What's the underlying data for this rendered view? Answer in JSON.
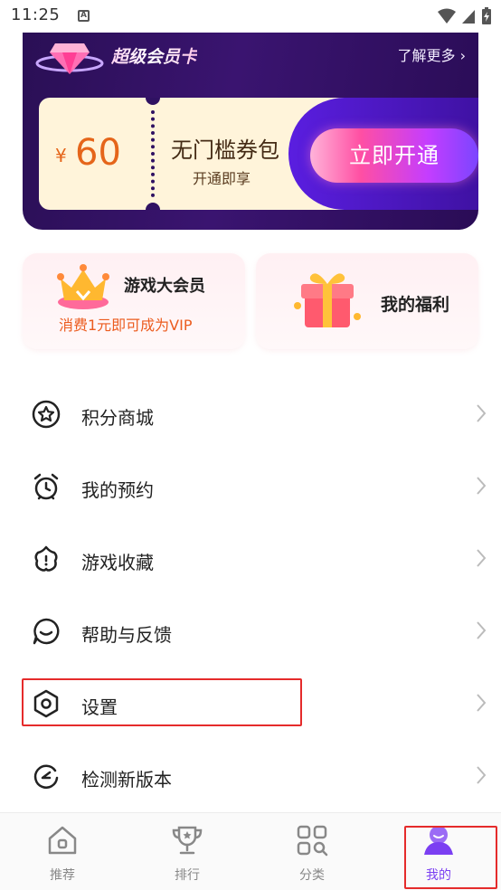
{
  "status_bar": {
    "time": "11:25",
    "app_icon_letter": "A"
  },
  "vip_card": {
    "title": "超级会员卡",
    "more_link": "了解更多 ›",
    "coupon": {
      "currency": "¥",
      "amount": "60",
      "name": "无门槛券包",
      "subtitle": "开通即享"
    },
    "open_button": "立即开通"
  },
  "promos": {
    "left": {
      "title": "游戏大会员",
      "subtitle": "消费1元即可成为VIP"
    },
    "right": {
      "title": "我的福利"
    }
  },
  "menu": [
    {
      "label": "积分商城",
      "icon": "star-circle-icon"
    },
    {
      "label": "我的预约",
      "icon": "alarm-clock-icon"
    },
    {
      "label": "游戏收藏",
      "icon": "flower-star-icon"
    },
    {
      "label": "帮助与反馈",
      "icon": "chat-smile-icon"
    },
    {
      "label": "设置",
      "icon": "hexagon-settings-icon"
    },
    {
      "label": "检测新版本",
      "icon": "refresh-icon"
    }
  ],
  "bottom_nav": [
    {
      "label": "推荐",
      "icon": "home-icon"
    },
    {
      "label": "排行",
      "icon": "trophy-icon"
    },
    {
      "label": "分类",
      "icon": "grid-icon"
    },
    {
      "label": "我的",
      "icon": "profile-icon",
      "active": true
    }
  ],
  "colors": {
    "accent": "#7b3ff2",
    "highlight": "#e52b2b",
    "coupon_orange": "#e5651a",
    "vip_bg": "#2a0f55"
  }
}
